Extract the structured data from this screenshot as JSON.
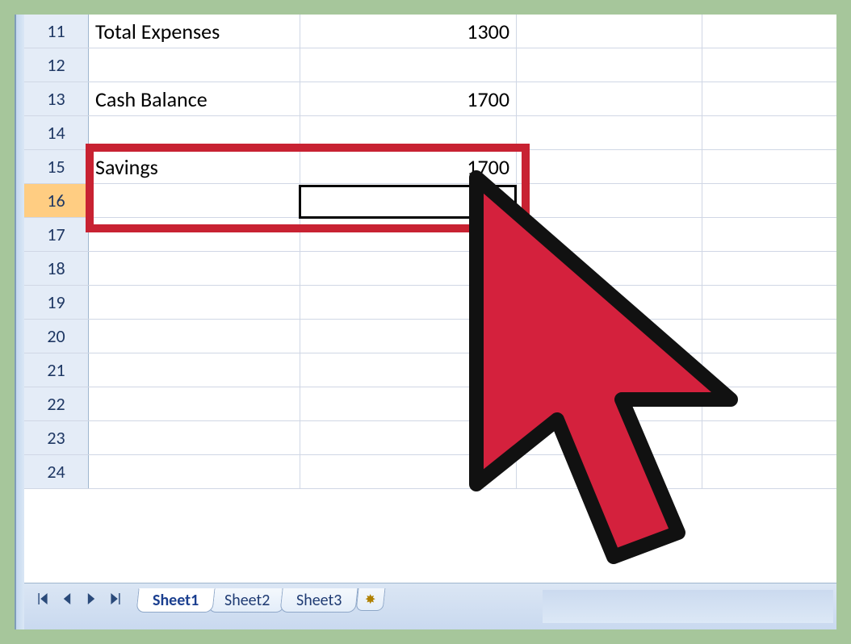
{
  "rows": [
    {
      "num": "11",
      "a": "Total Expenses",
      "b": "1300"
    },
    {
      "num": "12",
      "a": "",
      "b": ""
    },
    {
      "num": "13",
      "a": "Cash Balance",
      "b": "1700"
    },
    {
      "num": "14",
      "a": "",
      "b": ""
    },
    {
      "num": "15",
      "a": "Savings",
      "b": "1700"
    },
    {
      "num": "16",
      "a": "",
      "b": ""
    },
    {
      "num": "17",
      "a": "",
      "b": ""
    },
    {
      "num": "18",
      "a": "",
      "b": ""
    },
    {
      "num": "19",
      "a": "",
      "b": ""
    },
    {
      "num": "20",
      "a": "",
      "b": ""
    },
    {
      "num": "21",
      "a": "",
      "b": ""
    },
    {
      "num": "22",
      "a": "",
      "b": ""
    },
    {
      "num": "23",
      "a": "",
      "b": ""
    },
    {
      "num": "24",
      "a": "",
      "b": ""
    }
  ],
  "active_row": "16",
  "sheets": {
    "tabs": [
      {
        "label": "Sheet1",
        "active": true
      },
      {
        "label": "Sheet2",
        "active": false
      },
      {
        "label": "Sheet3",
        "active": false
      }
    ]
  }
}
